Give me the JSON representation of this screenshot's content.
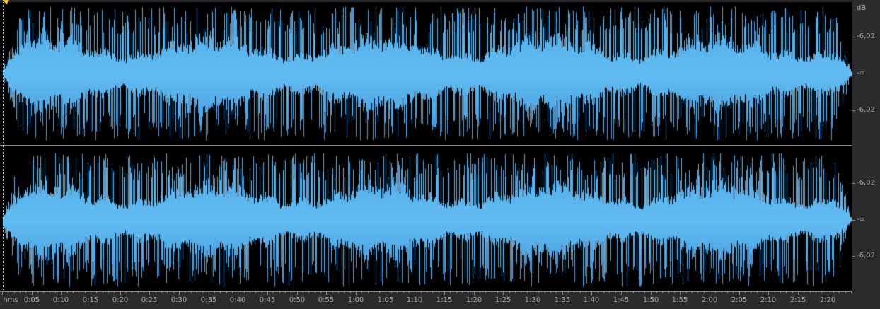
{
  "colors": {
    "waveform": "#4aa6e6",
    "waveform_light": "#63bdf2",
    "background": "#000000",
    "playhead": "#f2c318"
  },
  "db_scale": {
    "unit": "dB",
    "channel_top": [
      "-6,02",
      "-∞",
      "-6,02"
    ],
    "channel_bottom": [
      "-6,02",
      "-∞",
      "-6,02"
    ]
  },
  "ruler": {
    "unit_label": "hms",
    "labels": [
      "0:05",
      "0:10",
      "0:15",
      "0:20",
      "0:25",
      "0:30",
      "0:35",
      "0:40",
      "0:45",
      "0:50",
      "0:55",
      "1:00",
      "1:05",
      "1:10",
      "1:15",
      "1:20",
      "1:25",
      "1:30",
      "1:35",
      "1:40",
      "1:45",
      "1:50",
      "1:55",
      "2:00",
      "2:05",
      "2:10",
      "2:15",
      "2:20"
    ]
  },
  "icons": {
    "playhead": "playhead-marker-icon"
  }
}
